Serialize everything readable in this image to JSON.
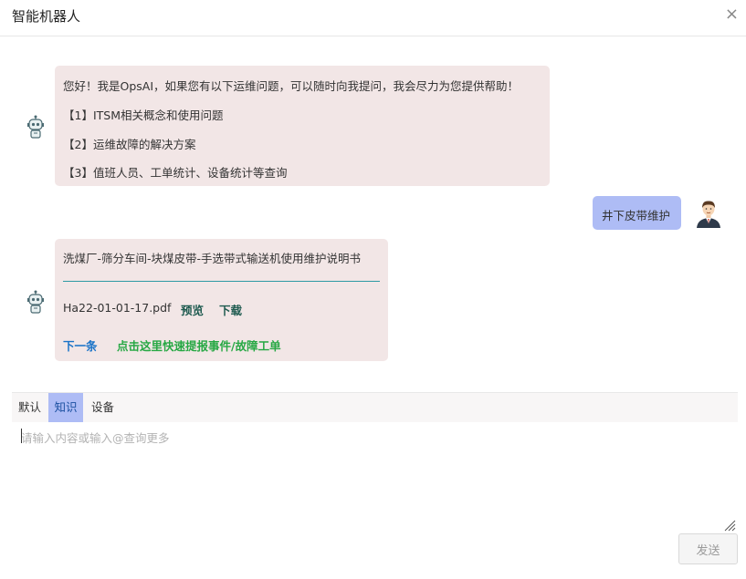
{
  "header": {
    "title": "智能机器人",
    "close_icon": "×"
  },
  "messages": {
    "bot1": {
      "greeting": "您好！我是OpsAI，如果您有以下运维问题，可以随时向我提问，我会尽力为您提供帮助！",
      "items": [
        "【1】ITSM相关概念和使用问题",
        "【2】运维故障的解决方案",
        "【3】值班人员、工单统计、设备统计等查询"
      ]
    },
    "user1": {
      "text": "井下皮带维护"
    },
    "bot2": {
      "doc_title": "洗煤厂-筛分车间-块煤皮带-手选带式输送机使用维护说明书",
      "file_name": "Ha22-01-01-17.pdf",
      "preview_label": "预览",
      "download_label": "下载",
      "next_label": "下一条",
      "ticket_label": "点击这里快速提报事件/故障工单"
    }
  },
  "tabs": [
    {
      "label": "默认",
      "active": false
    },
    {
      "label": "知识",
      "active": true
    },
    {
      "label": "设备",
      "active": false
    }
  ],
  "input": {
    "placeholder": "请输入内容或输入@查询更多",
    "value": ""
  },
  "send_label": "发送",
  "colors": {
    "bot_bubble": "#f2e6e6",
    "user_bubble": "#aebcf5",
    "active_tab": "#aebcf5",
    "link_blue": "#1a73c8",
    "link_green": "#27a844"
  }
}
